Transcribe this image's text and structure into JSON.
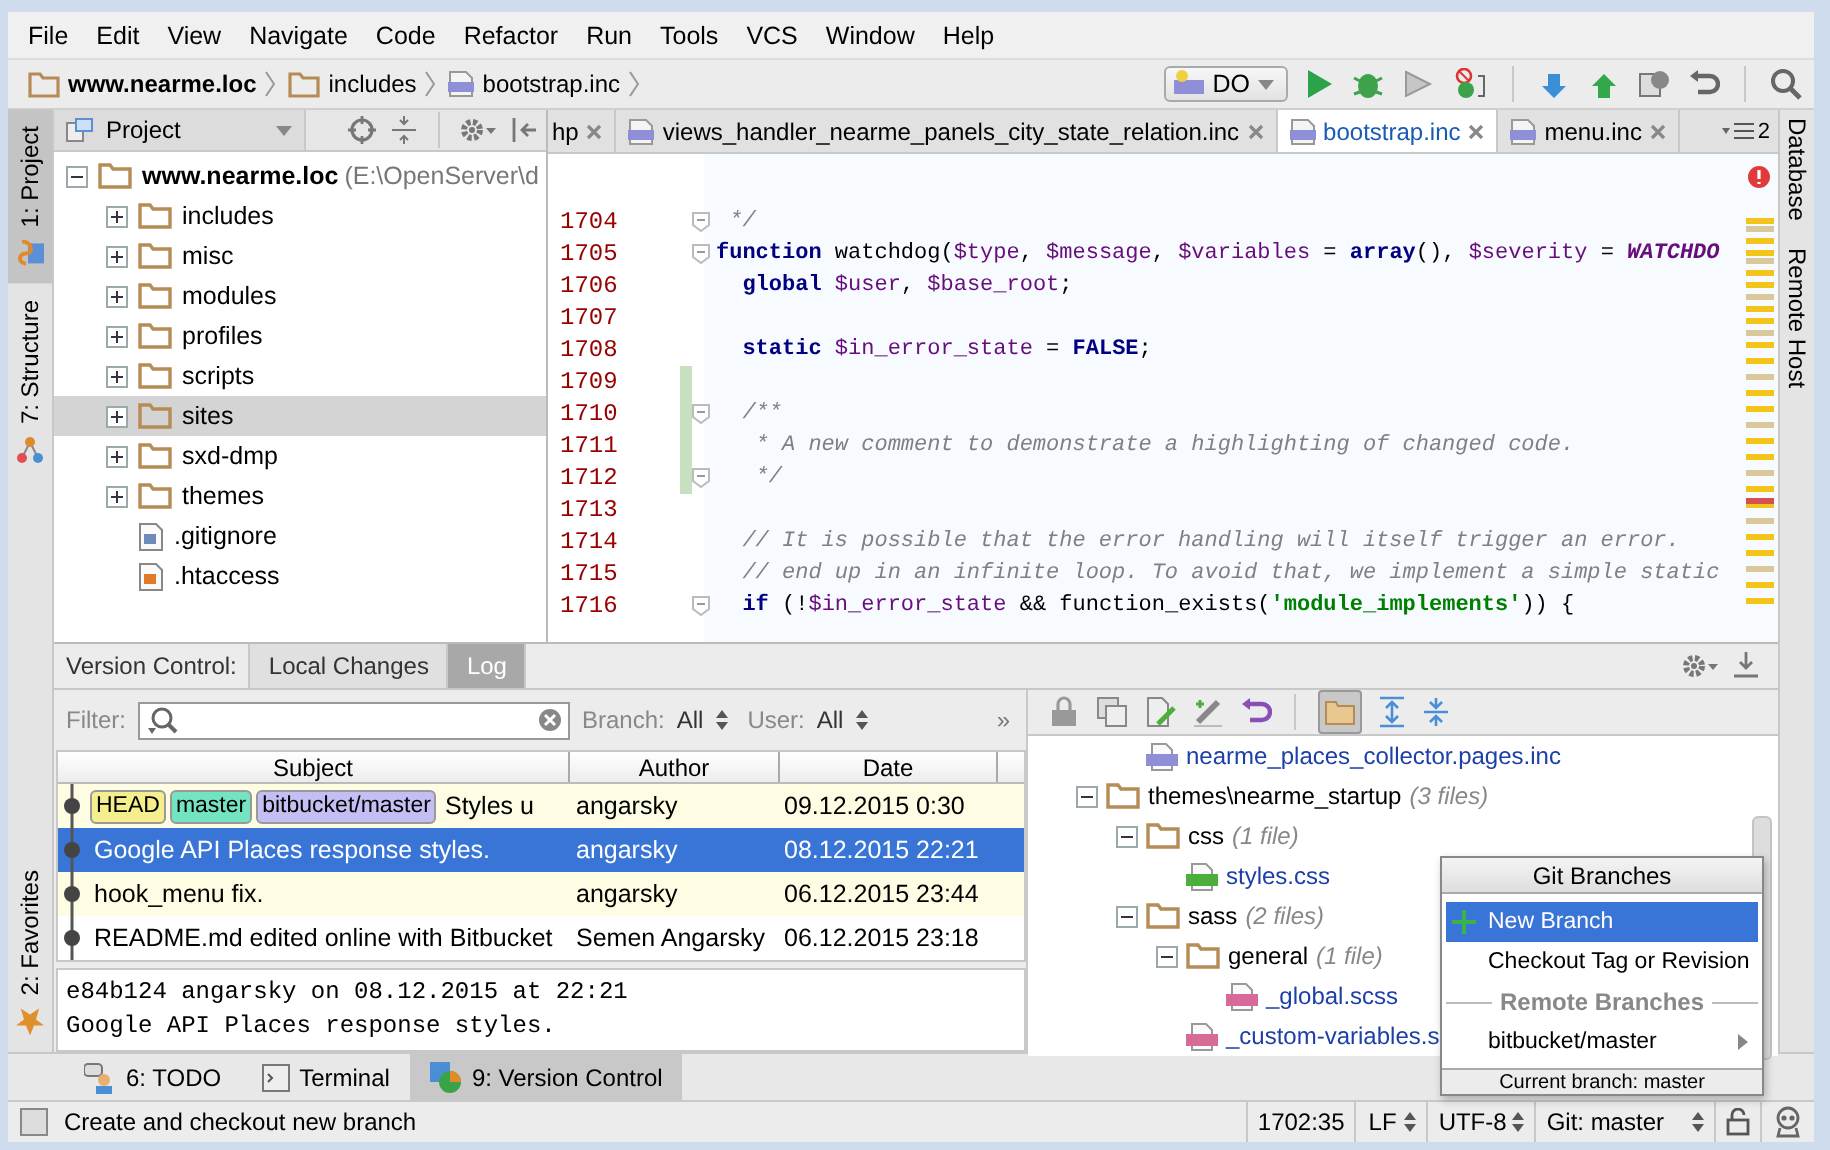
{
  "menu": [
    "File",
    "Edit",
    "View",
    "Navigate",
    "Code",
    "Refactor",
    "Run",
    "Tools",
    "VCS",
    "Window",
    "Help"
  ],
  "breadcrumbs": [
    {
      "label": "www.nearme.loc",
      "kind": "folder",
      "bold": true
    },
    {
      "label": "includes",
      "kind": "folder",
      "bold": false
    },
    {
      "label": "bootstrap.inc",
      "kind": "php",
      "bold": false
    }
  ],
  "run_config": {
    "label": "DO"
  },
  "left_strip": {
    "top": [
      {
        "label": "1: Project",
        "kind": "project",
        "selected": true
      },
      {
        "label": "7: Structure",
        "kind": "structure",
        "selected": false
      }
    ],
    "bottom": [
      {
        "label": "2: Favorites",
        "kind": "favorites",
        "selected": false
      }
    ]
  },
  "right_strip": [
    {
      "label": "Database"
    },
    {
      "label": "Remote Host"
    }
  ],
  "project_panel": {
    "title": "Project",
    "tree": [
      {
        "name": "www.nearme.loc",
        "path": "(E:\\OpenServer\\d",
        "kind": "folder",
        "expanded": true,
        "selected": false,
        "children": [
          {
            "name": "includes",
            "kind": "folder",
            "expanded": false,
            "selected": false
          },
          {
            "name": "misc",
            "kind": "folder",
            "expanded": false,
            "selected": false
          },
          {
            "name": "modules",
            "kind": "folder",
            "expanded": false,
            "selected": false
          },
          {
            "name": "profiles",
            "kind": "folder",
            "expanded": false,
            "selected": false
          },
          {
            "name": "scripts",
            "kind": "folder",
            "expanded": false,
            "selected": false
          },
          {
            "name": "sites",
            "kind": "folder",
            "expanded": false,
            "selected": true
          },
          {
            "name": "sxd-dmp",
            "kind": "folder",
            "expanded": false,
            "selected": false
          },
          {
            "name": "themes",
            "kind": "folder",
            "expanded": false,
            "selected": false
          },
          {
            "name": ".gitignore",
            "kind": "text",
            "selected": false
          },
          {
            "name": ".htaccess",
            "kind": "htaccess",
            "selected": false
          }
        ]
      }
    ]
  },
  "editor": {
    "tabs": [
      {
        "label": "hp",
        "kind": "cut",
        "selected": false
      },
      {
        "label": "views_handler_nearme_panels_city_state_relation.inc",
        "kind": "php",
        "selected": false
      },
      {
        "label": "bootstrap.inc",
        "kind": "php",
        "selected": true
      },
      {
        "label": "menu.inc",
        "kind": "php",
        "selected": false
      }
    ],
    "hidden_tabs": "2",
    "lines": [
      {
        "number": "1704",
        "fold": true,
        "changed": false,
        "tokens": [
          {
            "kind": "comment",
            "text": " */"
          }
        ]
      },
      {
        "number": "1705",
        "fold": true,
        "changed": false,
        "tokens": [
          {
            "kind": "keyword",
            "text": "function"
          },
          {
            "kind": "plain",
            "text": " watchdog("
          },
          {
            "kind": "var",
            "text": "$type"
          },
          {
            "kind": "plain",
            "text": ", "
          },
          {
            "kind": "var",
            "text": "$message"
          },
          {
            "kind": "plain",
            "text": ", "
          },
          {
            "kind": "var",
            "text": "$variables"
          },
          {
            "kind": "plain",
            "text": " = "
          },
          {
            "kind": "keyword",
            "text": "array"
          },
          {
            "kind": "plain",
            "text": "(), "
          },
          {
            "kind": "var",
            "text": "$severity"
          },
          {
            "kind": "plain",
            "text": " = "
          },
          {
            "kind": "constant",
            "text": "WATCHDO"
          }
        ]
      },
      {
        "number": "1706",
        "fold": false,
        "changed": false,
        "tokens": [
          {
            "kind": "keyword",
            "text": "  global "
          },
          {
            "kind": "var",
            "text": "$user"
          },
          {
            "kind": "plain",
            "text": ", "
          },
          {
            "kind": "var",
            "text": "$base_root"
          },
          {
            "kind": "plain",
            "text": ";"
          }
        ]
      },
      {
        "number": "1707",
        "fold": false,
        "changed": false
      },
      {
        "number": "1708",
        "fold": false,
        "changed": false,
        "tokens": [
          {
            "kind": "keyword",
            "text": "  static "
          },
          {
            "kind": "var",
            "text": "$in_error_state"
          },
          {
            "kind": "plain",
            "text": " = "
          },
          {
            "kind": "keyword",
            "text": "FALSE"
          },
          {
            "kind": "plain",
            "text": ";"
          }
        ]
      },
      {
        "number": "1709",
        "fold": false,
        "changed": true
      },
      {
        "number": "1710",
        "fold": true,
        "changed": true,
        "tokens": [
          {
            "kind": "comment",
            "text": "  /**"
          }
        ]
      },
      {
        "number": "1711",
        "fold": false,
        "changed": true,
        "tokens": [
          {
            "kind": "comment",
            "text": "   * A new comment to demonstrate a highlighting of changed code."
          }
        ]
      },
      {
        "number": "1712",
        "fold": true,
        "changed": true,
        "tokens": [
          {
            "kind": "comment",
            "text": "   */"
          }
        ]
      },
      {
        "number": "1713",
        "fold": false,
        "changed": false
      },
      {
        "number": "1714",
        "fold": false,
        "changed": false,
        "tokens": [
          {
            "kind": "comment",
            "text": "  // It is possible that the error handling will itself trigger an error."
          }
        ]
      },
      {
        "number": "1715",
        "fold": false,
        "changed": false,
        "tokens": [
          {
            "kind": "comment",
            "text": "  // end up in an infinite loop. To avoid that, we implement a simple static"
          }
        ]
      },
      {
        "number": "1716",
        "fold": true,
        "changed": false,
        "tokens": [
          {
            "kind": "keyword",
            "text": "  if"
          },
          {
            "kind": "plain",
            "text": " (!"
          },
          {
            "kind": "var",
            "text": "$in_error_state"
          },
          {
            "kind": "plain",
            "text": " && function_exists("
          },
          {
            "kind": "string",
            "text": "'module_implements'"
          },
          {
            "kind": "plain",
            "text": ")) {"
          }
        ]
      }
    ]
  },
  "vcs_panel": {
    "title": "Version Control:",
    "tabs": [
      {
        "label": "Local Changes",
        "selected": false
      },
      {
        "label": "Log",
        "selected": true
      }
    ],
    "filter": {
      "label": "Filter:",
      "branch_label": "Branch:",
      "branch_value": "All",
      "user_label": "User:",
      "user_value": "All",
      "more": "»"
    },
    "columns": [
      "Subject",
      "Author",
      "Date"
    ],
    "commits": [
      {
        "refs": [
          {
            "label": "HEAD",
            "color": "#f4ef8c"
          },
          {
            "label": "master",
            "color": "#74e3c2"
          },
          {
            "label": "bitbucket/master",
            "color": "#c3bff5"
          }
        ],
        "subject": "Styles u",
        "author": "angarsky",
        "date": "09.12.2015 0:30",
        "selected": false,
        "highlighted": true
      },
      {
        "subject": "Google API Places response styles.",
        "author": "angarsky",
        "date": "08.12.2015 22:21",
        "selected": true,
        "highlighted": false
      },
      {
        "subject": "hook_menu fix.",
        "author": "angarsky",
        "date": "06.12.2015 23:44",
        "selected": false,
        "highlighted": true
      },
      {
        "subject": "README.md edited online with Bitbucket",
        "author": "Semen Angarsky",
        "date": "06.12.2015 23:18",
        "selected": false,
        "highlighted": false
      }
    ],
    "details": [
      "e84b124 angarsky on 08.12.2015 at 22:21",
      "Google API Places response styles."
    ],
    "changes_tree": [
      {
        "kind": "scrolled",
        "children": [
          {
            "name": "nearme_places_collector.pages.inc",
            "kind": "php"
          }
        ]
      },
      {
        "name": "themes\\nearme_startup",
        "count": "(3 files)",
        "kind": "folder",
        "expanded": true,
        "children": [
          {
            "name": "css",
            "count": "(1 file)",
            "kind": "folder",
            "expanded": true,
            "children": [
              {
                "name": "styles.css",
                "kind": "css"
              }
            ]
          },
          {
            "name": "sass",
            "count": "(2 files)",
            "kind": "folder",
            "expanded": true,
            "children": [
              {
                "name": "general",
                "count": "(1 file)",
                "kind": "folder",
                "expanded": true,
                "children": [
                  {
                    "name": "_global.scss",
                    "kind": "sass"
                  }
                ]
              },
              {
                "name": "_custom-variables.s",
                "kind": "sass"
              }
            ]
          }
        ]
      }
    ]
  },
  "branches_popup": {
    "title": "Git Branches",
    "items": [
      {
        "kind": "new",
        "label": "New Branch",
        "selected": true
      },
      {
        "kind": "action",
        "label": "Checkout Tag or Revision",
        "selected": false
      },
      {
        "kind": "header",
        "label": "Remote Branches",
        "selected": false
      },
      {
        "kind": "branch",
        "label": "bitbucket/master",
        "selected": false
      }
    ],
    "footer": "Current branch: master"
  },
  "tool_buttons": [
    {
      "label": "6: TODO",
      "kind": "todo",
      "selected": false
    },
    {
      "label": "Terminal",
      "kind": "terminal",
      "selected": false
    },
    {
      "label": "9: Version Control",
      "kind": "vcs",
      "selected": true
    }
  ],
  "status_bar": {
    "message": "Create and checkout new branch",
    "position": "1702:35",
    "line_separator": "LF",
    "encoding": "UTF-8",
    "vcs_branch": "Git: master"
  }
}
